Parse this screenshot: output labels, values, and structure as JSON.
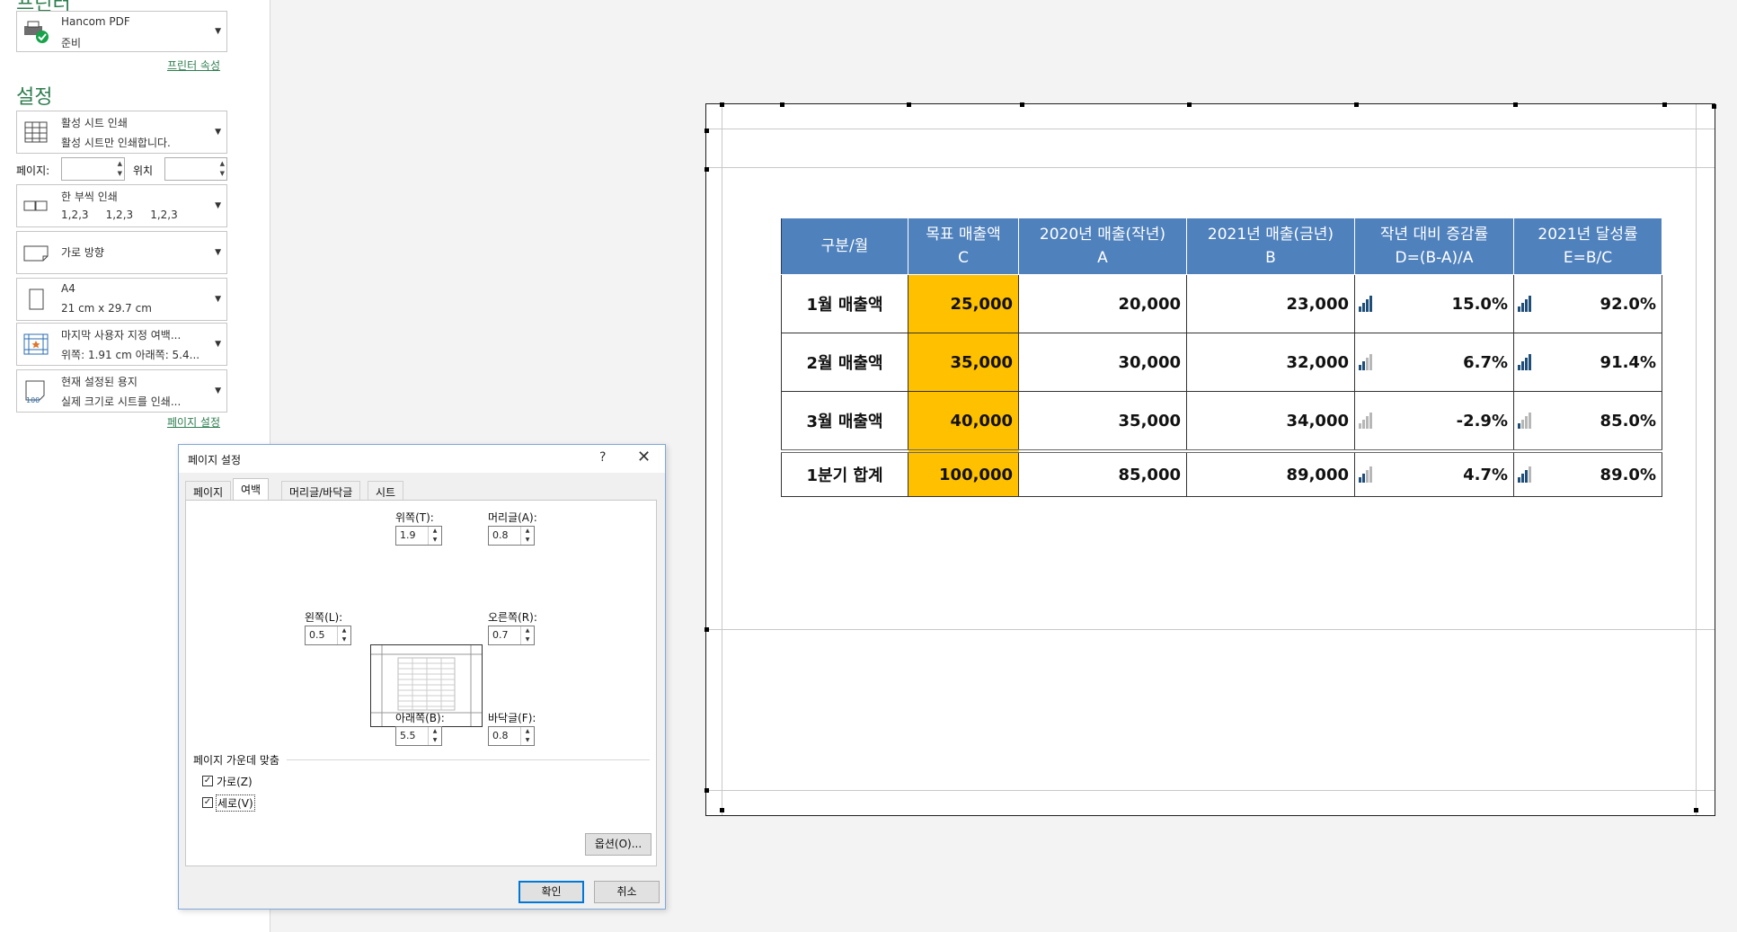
{
  "printer": {
    "section_title": "프린터",
    "name": "Hancom PDF",
    "status": "준비",
    "properties_link": "프린터 속성"
  },
  "settings": {
    "section_title": "설정",
    "print_what": {
      "line1": "활성 시트 인쇄",
      "line2": "활성 시트만 인쇄합니다."
    },
    "pages_label": "페이지:",
    "pages_from": "",
    "to_label": "위치",
    "pages_to": "",
    "collate": {
      "line1": "한 부씩 인쇄",
      "line2": "1,2,3     1,2,3     1,2,3"
    },
    "orientation": {
      "line1": "가로 방향"
    },
    "paper": {
      "line1": "A4",
      "line2": "21 cm x 29.7 cm"
    },
    "margins": {
      "line1": "마지막 사용자 지정 여백...",
      "line2": "위쪽: 1.91 cm 아래쪽: 5.4..."
    },
    "scaling": {
      "line1": "현재 설정된 용지",
      "line2": "실제 크기로 시트를 인쇄..."
    },
    "page_setup_link": "페이지 설정"
  },
  "dialog": {
    "title": "페이지 설정",
    "help": "?",
    "close": "✕",
    "tabs": [
      "페이지",
      "여백",
      "머리글/바닥글",
      "시트"
    ],
    "active_tab": "여백",
    "top_label": "위쪽(T):",
    "top_value": "1.9",
    "header_label": "머리글(A):",
    "header_value": "0.8",
    "left_label": "왼쪽(L):",
    "left_value": "0.5",
    "right_label": "오른쪽(R):",
    "right_value": "0.7",
    "bottom_label": "아래쪽(B):",
    "bottom_value": "5.5",
    "footer_label": "바닥글(F):",
    "footer_value": "0.8",
    "center_group": "페이지 가운데 맞춤",
    "horizontal_label": "가로(Z)",
    "horizontal_checked": true,
    "vertical_label": "세로(V)",
    "vertical_checked": true,
    "options_button": "옵션(O)...",
    "ok_button": "확인",
    "cancel_button": "취소"
  },
  "table": {
    "headers": [
      {
        "l1": "구분/월",
        "l2": ""
      },
      {
        "l1": "목표 매출액",
        "l2": "C"
      },
      {
        "l1": "2020년 매출(작년)",
        "l2": "A"
      },
      {
        "l1": "2021년 매출(금년)",
        "l2": "B"
      },
      {
        "l1": "작년 대비 증감률",
        "l2": "D=(B-A)/A"
      },
      {
        "l1": "2021년 달성률",
        "l2": "E=B/C"
      }
    ],
    "rows": [
      {
        "label": "1월 매출액",
        "target": "25,000",
        "y2020": "20,000",
        "y2021": "23,000",
        "growth": "15.0%",
        "achieve": "92.0%"
      },
      {
        "label": "2월 매출액",
        "target": "35,000",
        "y2020": "30,000",
        "y2021": "32,000",
        "growth": "6.7%",
        "achieve": "91.4%"
      },
      {
        "label": "3월 매출액",
        "target": "40,000",
        "y2020": "35,000",
        "y2021": "34,000",
        "growth": "-2.9%",
        "achieve": "85.0%"
      },
      {
        "label": "1분기 합계",
        "target": "100,000",
        "y2020": "85,000",
        "y2021": "89,000",
        "growth": "4.7%",
        "achieve": "89.0%"
      }
    ],
    "accent_header": "#4f81bd",
    "accent_target": "#ffc000"
  }
}
